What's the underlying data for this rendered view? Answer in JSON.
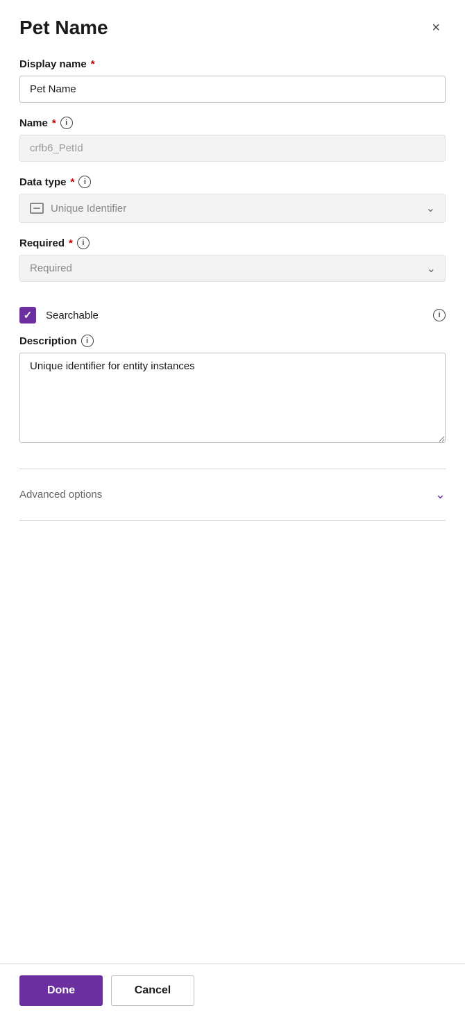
{
  "panel": {
    "title": "Pet Name",
    "close_label": "×"
  },
  "display_name_field": {
    "label": "Display name",
    "required": true,
    "value": "Pet Name",
    "placeholder": "Pet Name"
  },
  "name_field": {
    "label": "Name",
    "required": true,
    "value": "crfb6_PetId",
    "placeholder": "crfb6_PetId"
  },
  "data_type_field": {
    "label": "Data type",
    "required": true,
    "value": "Unique Identifier",
    "icon_label": "unique-identifier-icon"
  },
  "required_field": {
    "label": "Required",
    "required": true,
    "value": "Required",
    "placeholder": "Required"
  },
  "searchable": {
    "label": "Searchable",
    "checked": true
  },
  "description_field": {
    "label": "Description",
    "value": "Unique identifier for entity instances",
    "placeholder": ""
  },
  "advanced_options": {
    "label": "Advanced options"
  },
  "footer": {
    "done_label": "Done",
    "cancel_label": "Cancel"
  },
  "icons": {
    "info": "i",
    "chevron_down": "∨",
    "close": "×",
    "checkmark": "✓"
  }
}
